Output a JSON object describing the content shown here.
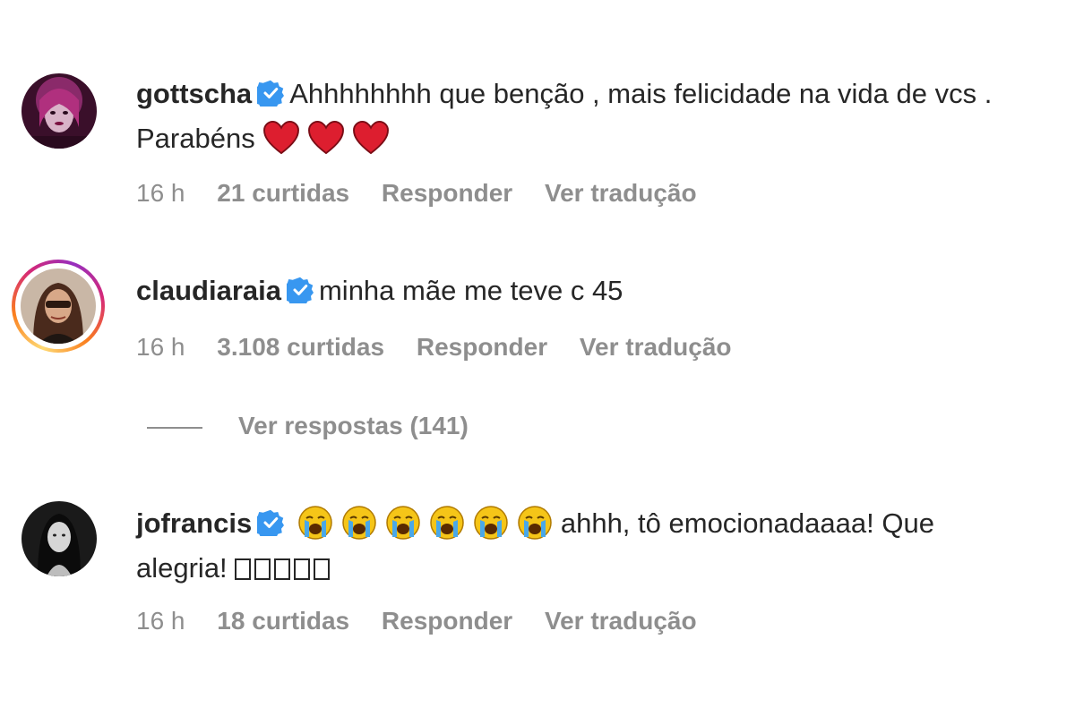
{
  "comments": [
    {
      "username": "gottscha",
      "text": "Ahhhhhhhh que benção , mais felicidade na vida de vcs . Parabéns",
      "emoji_count": 3,
      "time": "16 h",
      "likes": "21 curtidas",
      "reply_label": "Responder",
      "translate_label": "Ver tradução"
    },
    {
      "username": "claudiaraia",
      "text": "minha mãe me teve c 45",
      "time": "16 h",
      "likes": "3.108 curtidas",
      "reply_label": "Responder",
      "translate_label": "Ver tradução",
      "replies_label": "Ver respostas (141)"
    },
    {
      "username": "jofrancis",
      "text_line1": "ahhh, tô emocionadaaaa! Que",
      "text_line2": "alegria!",
      "emoji_count": 6,
      "time": "16 h",
      "likes": "18 curtidas",
      "reply_label": "Responder",
      "translate_label": "Ver tradução"
    }
  ],
  "colors": {
    "text": "#262626",
    "meta": "#8e8e8e",
    "verified": "#3897f0",
    "heart": "#e0245e"
  },
  "icons": [
    "verified-badge-icon",
    "red-heart-emoji",
    "crying-face-emoji",
    "missing-glyph-box"
  ]
}
